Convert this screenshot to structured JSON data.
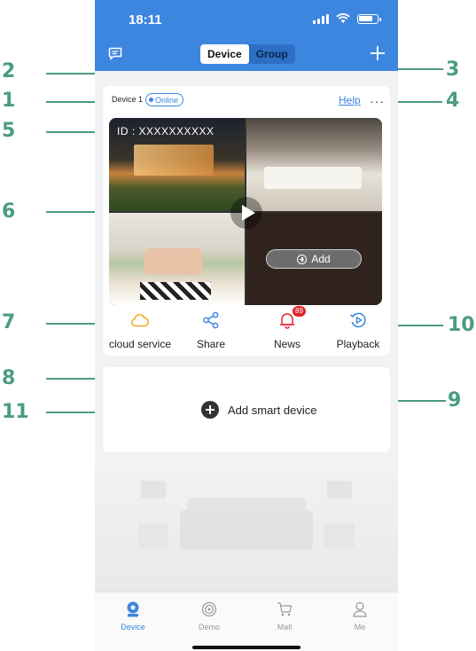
{
  "status_bar": {
    "time": "18:11"
  },
  "header": {
    "segments": [
      {
        "label": "Device",
        "active": true
      },
      {
        "label": "Group",
        "active": false
      }
    ],
    "accent_color": "#3d86e0",
    "icons": {
      "left": "message-icon",
      "right": "plus-icon"
    }
  },
  "device_card": {
    "name": "Device 1",
    "status": "Online",
    "help_label": "Help",
    "more_label": "···",
    "camera_id": "ID : XXXXXXXXXX",
    "add_label": "Add",
    "actions": [
      {
        "label": "cloud service",
        "icon": "cloud-icon",
        "color": "#f5a623"
      },
      {
        "label": "Share",
        "icon": "share-icon",
        "color": "#3d86e0"
      },
      {
        "label": "News",
        "icon": "bell-icon",
        "color": "#e0262b",
        "badge": "89"
      },
      {
        "label": "Playback",
        "icon": "playback-icon",
        "color": "#3d86e0"
      }
    ]
  },
  "add_device": {
    "label": "Add smart device"
  },
  "tabs": [
    {
      "label": "Device",
      "icon": "device-icon",
      "active": true
    },
    {
      "label": "Demo",
      "icon": "demo-icon",
      "active": false
    },
    {
      "label": "Mall",
      "icon": "cart-icon",
      "active": false
    },
    {
      "label": "Me",
      "icon": "person-icon",
      "active": false
    }
  ],
  "callouts": [
    "1",
    "2",
    "3",
    "4",
    "5",
    "6",
    "7",
    "8",
    "9",
    "10",
    "11"
  ]
}
